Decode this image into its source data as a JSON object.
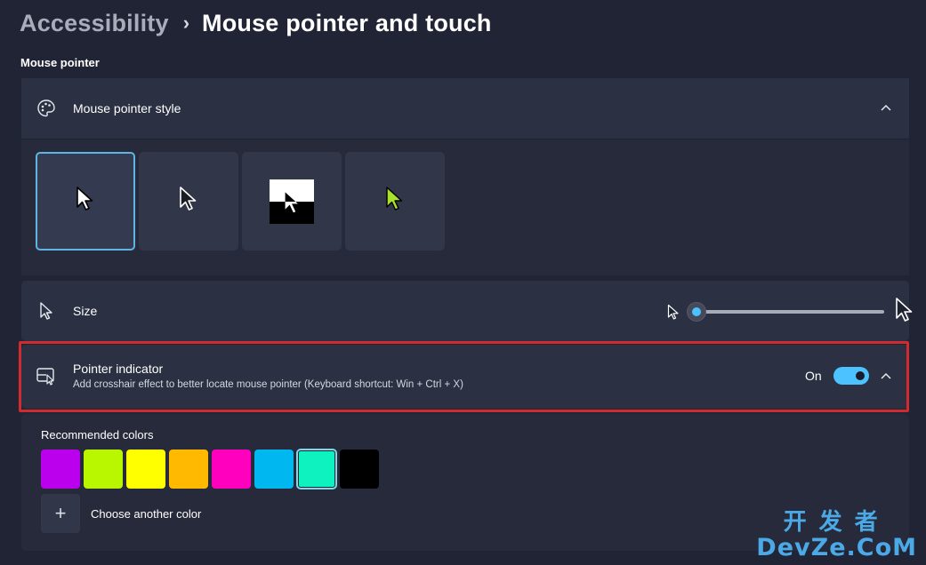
{
  "breadcrumb": {
    "parent": "Accessibility",
    "separator": "›",
    "current": "Mouse pointer and touch"
  },
  "section_label": "Mouse pointer",
  "pointer_style": {
    "title": "Mouse pointer style",
    "icon": "palette-icon",
    "expanded": true,
    "options": [
      {
        "name": "white",
        "icon": "white-cursor-icon",
        "selected": true
      },
      {
        "name": "black",
        "icon": "black-cursor-icon",
        "selected": false
      },
      {
        "name": "inverted",
        "icon": "inverted-cursor-icon",
        "selected": false
      },
      {
        "name": "custom",
        "icon": "custom-color-cursor-icon",
        "selected": false
      }
    ]
  },
  "size": {
    "title": "Size",
    "icon": "pointer-icon",
    "value": 1,
    "min": 1,
    "max": 15
  },
  "pointer_indicator": {
    "title": "Pointer indicator",
    "description": "Add crosshair effect to better locate mouse pointer (Keyboard shortcut: Win + Ctrl + X)",
    "toggle_label": "On",
    "toggle_on": true,
    "icon": "pointer-indicator-icon"
  },
  "recommended_colors": {
    "title": "Recommended colors",
    "swatches": [
      "#bb00ee",
      "#b9f700",
      "#ffff00",
      "#ffb900",
      "#ff00be",
      "#00b7f0",
      "#0ef2c0",
      "#000000"
    ],
    "selected_index": 6,
    "choose_another_label": "Choose another color"
  },
  "watermark": {
    "top": "开发者",
    "bottom": "DevZe.CoM"
  },
  "colors": {
    "accent": "#4cc2ff",
    "highlight": "#d12a2f",
    "custom_cursor": "#a8e22a"
  }
}
